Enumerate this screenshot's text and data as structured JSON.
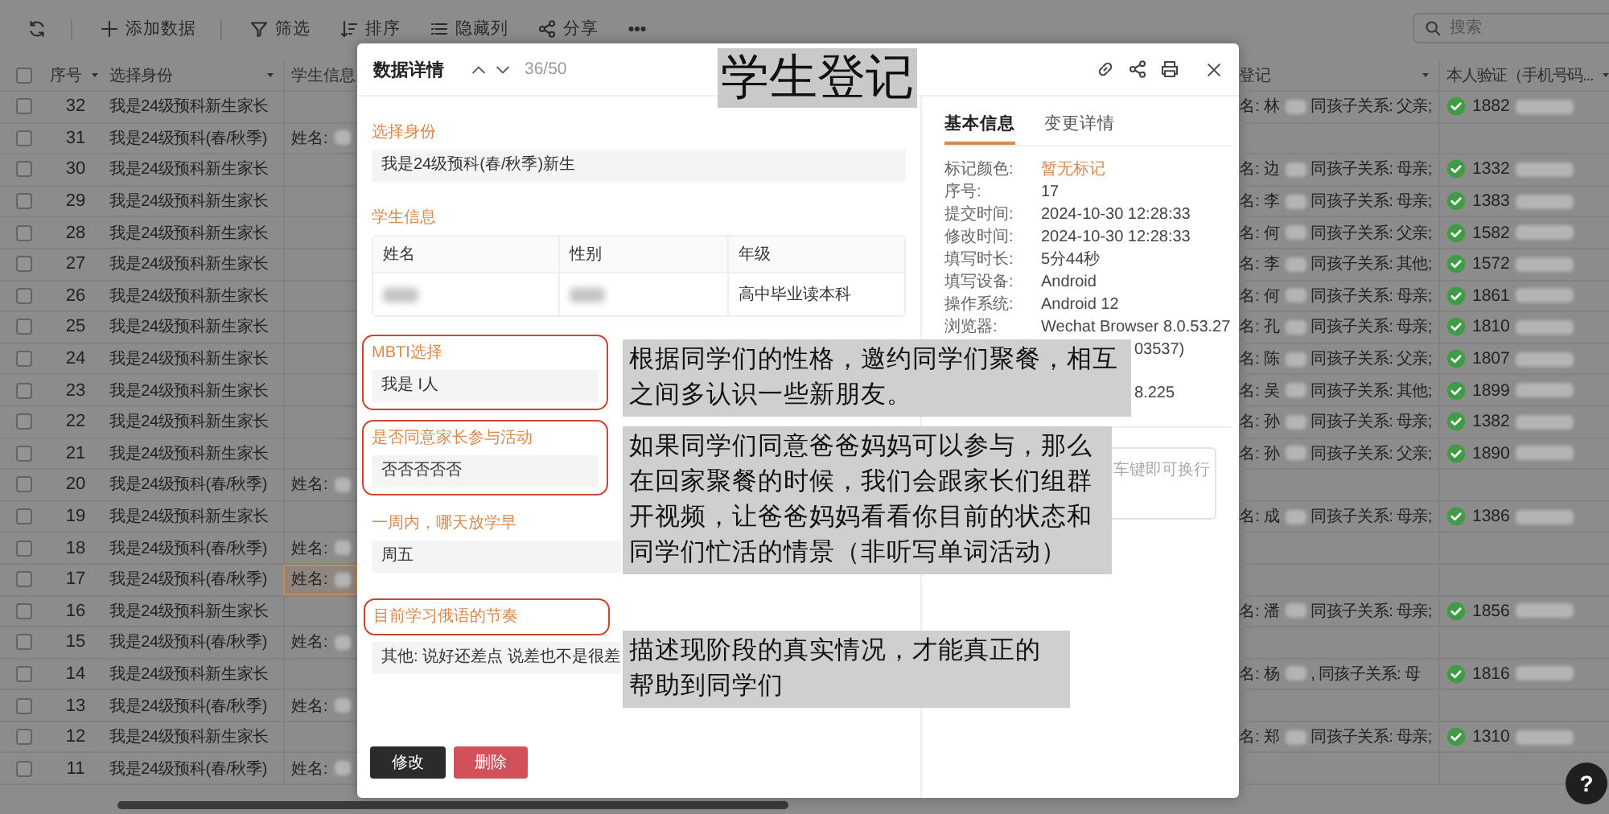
{
  "toolbar": [
    {
      "kind": "refresh"
    },
    {
      "kind": "add",
      "label": "添加数据"
    },
    {
      "kind": "filter",
      "label": "筛选"
    },
    {
      "kind": "sort",
      "label": "排序"
    },
    {
      "kind": "hide",
      "label": "隐藏列"
    },
    {
      "kind": "share",
      "label": "分享"
    },
    {
      "kind": "more"
    }
  ],
  "search": {
    "placeholder": "搜索"
  },
  "table": {
    "all_checked": false,
    "columns_left": [
      {
        "label": "序号",
        "menu": true
      },
      {
        "label": "选择身份",
        "menu": true
      },
      {
        "label": "学生信息",
        "menu": false
      }
    ],
    "columns_right": [
      {
        "label": "登记",
        "menu": true
      },
      {
        "label": "本人验证（手机号码...",
        "menu": true
      }
    ],
    "rows": [
      {
        "no": "32",
        "identity": "我是24级预科新生家长",
        "checked": false,
        "selected": false,
        "guardian": "名: 林",
        "relation": "同孩子关系: 父亲;",
        "verified": true,
        "phone": "1882"
      },
      {
        "no": "31",
        "identity": "我是24级预科(春/秋季)",
        "student_info": "姓名:",
        "checked": false,
        "selected": false,
        "verified": false
      },
      {
        "no": "30",
        "identity": "我是24级预科新生家长",
        "checked": false,
        "selected": false,
        "guardian": "名: 边",
        "relation": "同孩子关系: 母亲;",
        "verified": true,
        "phone": "1332"
      },
      {
        "no": "29",
        "identity": "我是24级预科新生家长",
        "checked": false,
        "selected": false,
        "guardian": "名: 李",
        "relation": "同孩子关系: 母亲;",
        "verified": true,
        "phone": "1383"
      },
      {
        "no": "28",
        "identity": "我是24级预科新生家长",
        "checked": false,
        "selected": false,
        "guardian": "名: 何",
        "relation": "同孩子关系: 父亲;",
        "verified": true,
        "phone": "1582"
      },
      {
        "no": "27",
        "identity": "我是24级预科新生家长",
        "checked": false,
        "selected": false,
        "guardian": "名: 李",
        "relation": "同孩子关系: 其他;",
        "verified": true,
        "phone": "1572"
      },
      {
        "no": "26",
        "identity": "我是24级预科新生家长",
        "checked": false,
        "selected": false,
        "guardian": "名: 何",
        "relation": "同孩子关系: 母亲;",
        "verified": true,
        "phone": "1861"
      },
      {
        "no": "25",
        "identity": "我是24级预科新生家长",
        "checked": false,
        "selected": false,
        "guardian": "名: 孔",
        "relation": "同孩子关系: 母亲;",
        "verified": true,
        "phone": "1810"
      },
      {
        "no": "24",
        "identity": "我是24级预科新生家长",
        "checked": false,
        "selected": false,
        "guardian": "名: 陈",
        "relation": "同孩子关系: 父亲;",
        "verified": true,
        "phone": "1807"
      },
      {
        "no": "23",
        "identity": "我是24级预科新生家长",
        "checked": false,
        "selected": false,
        "guardian": "名: 吴",
        "relation": "同孩子关系: 其他;",
        "verified": true,
        "phone": "1899"
      },
      {
        "no": "22",
        "identity": "我是24级预科新生家长",
        "checked": false,
        "selected": false,
        "guardian": "名: 孙",
        "relation": "同孩子关系: 母亲;",
        "verified": true,
        "phone": "1382"
      },
      {
        "no": "21",
        "identity": "我是24级预科新生家长",
        "checked": false,
        "selected": false,
        "guardian": "名: 孙",
        "relation": "同孩子关系: 父亲;",
        "verified": true,
        "phone": "1890"
      },
      {
        "no": "20",
        "identity": "我是24级预科(春/秋季)",
        "student_info": "姓名:",
        "checked": false,
        "selected": false,
        "verified": false
      },
      {
        "no": "19",
        "identity": "我是24级预科新生家长",
        "checked": false,
        "selected": false,
        "guardian": "名: 成",
        "relation": "同孩子关系: 母亲;",
        "verified": true,
        "phone": "1386"
      },
      {
        "no": "18",
        "identity": "我是24级预科(春/秋季)",
        "student_info": "姓名:",
        "checked": false,
        "selected": false,
        "verified": false
      },
      {
        "no": "17",
        "identity": "我是24级预科(春/秋季)",
        "student_info": "姓名:",
        "checked": false,
        "selected": true,
        "verified": false
      },
      {
        "no": "16",
        "identity": "我是24级预科新生家长",
        "checked": false,
        "selected": false,
        "guardian": "名: 潘",
        "relation": "同孩子关系: 母亲;",
        "verified": true,
        "phone": "1856"
      },
      {
        "no": "15",
        "identity": "我是24级预科(春/秋季)",
        "student_info": "姓名:",
        "checked": false,
        "selected": false,
        "verified": false
      },
      {
        "no": "14",
        "identity": "我是24级预科新生家长",
        "checked": false,
        "selected": false,
        "guardian": "名: 杨",
        "relation": ", 同孩子关系: 母",
        "verified": true,
        "phone": "1816"
      },
      {
        "no": "13",
        "identity": "我是24级预科(春/秋季)",
        "student_info": "姓名:",
        "checked": false,
        "selected": false,
        "verified": false
      },
      {
        "no": "12",
        "identity": "我是24级预科新生家长",
        "checked": false,
        "selected": false,
        "guardian": "名: 郑",
        "relation": "同孩子关系: 母亲;",
        "verified": true,
        "phone": "1310"
      },
      {
        "no": "11",
        "identity": "我是24级预科(春/秋季)",
        "student_info": "姓名:",
        "checked": false,
        "selected": false,
        "verified": false
      }
    ]
  },
  "modal": {
    "title": "数据详情",
    "counter": "36/50",
    "fields": [
      {
        "kind": "text",
        "label": "选择身份",
        "value": "我是24级预科(春/秋季)新生",
        "outlined": false,
        "label_outlined": false
      },
      {
        "kind": "table",
        "label": "学生信息",
        "columns": [
          "姓名",
          "性别",
          "年级"
        ],
        "cells": [
          {
            "kind": "blurred"
          },
          {
            "kind": "blurred"
          },
          {
            "kind": "text",
            "text": "高中毕业读本科"
          }
        ],
        "outlined": false,
        "label_outlined": false
      },
      {
        "kind": "text",
        "label": "MBTI选择",
        "value": "我是 I人",
        "outlined": true,
        "label_outlined": false
      },
      {
        "kind": "text",
        "label": "是否同意家长参与活动",
        "value": "否否否否否",
        "outlined": true,
        "label_outlined": false
      },
      {
        "kind": "text",
        "label": "一周内，哪天放学早",
        "value": "周五",
        "outlined": false,
        "label_outlined": false
      },
      {
        "kind": "text",
        "label": "目前学习俄语的节奏",
        "value": "其他: 说好还差点 说差也不是很差",
        "outlined": false,
        "label_outlined": true
      }
    ],
    "buttons": [
      {
        "kind": "primary",
        "label": "修改"
      },
      {
        "kind": "danger",
        "label": "删除"
      }
    ],
    "info_tabs": [
      {
        "label": "基本信息",
        "selected": true
      },
      {
        "label": "变更详情",
        "selected": false
      }
    ],
    "info": [
      {
        "kind": "tag",
        "label": "标记颜色:",
        "value": "暂无标记"
      },
      {
        "kind": "text",
        "label": "序号:",
        "value": "17"
      },
      {
        "kind": "text",
        "label": "提交时间:",
        "value": "2024-10-30 12:28:33"
      },
      {
        "kind": "text",
        "label": "修改时间:",
        "value": "2024-10-30 12:28:33"
      },
      {
        "kind": "text",
        "label": "填写时长:",
        "value": "5分44秒"
      },
      {
        "kind": "text",
        "label": "填写设备:",
        "value": "Android"
      },
      {
        "kind": "text",
        "label": "操作系统:",
        "value": "Android 12"
      },
      {
        "kind": "text",
        "label": "浏览器:",
        "value": "Wechat Browser 8.0.53.27"
      },
      {
        "kind": "continued",
        "value": "03537)"
      },
      {
        "kind": "continued",
        "value": "8.225"
      }
    ],
    "comment": {
      "placeholder": "车键即可换行"
    }
  },
  "annotations": [
    {
      "kind": "title",
      "text": "学生登记"
    },
    {
      "kind": "note",
      "text": "根据同学们的性格，邀约同学们聚餐，相互之间多认识一些新朋友。"
    },
    {
      "kind": "note",
      "text": "如果同学们同意爸爸妈妈可以参与，那么在回家聚餐的时候，我们会跟家长们组群开视频，让爸爸妈妈看看你目前的状态和同学们忙活的情景（非听写单词活动）"
    },
    {
      "kind": "note",
      "text": "描述现阶段的真实情况，才能真正的帮助到同学们"
    }
  ],
  "help_button": "?"
}
